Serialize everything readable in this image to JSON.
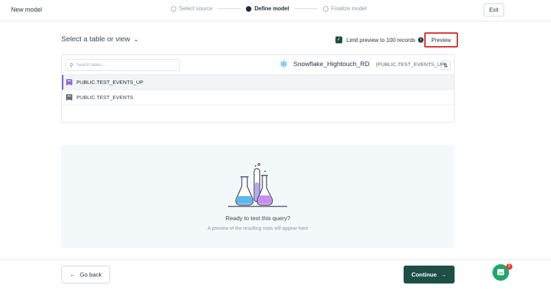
{
  "header": {
    "title": "New model",
    "steps": [
      {
        "label": "Select source",
        "state": "done"
      },
      {
        "label": "Define model",
        "state": "active"
      },
      {
        "label": "Finalize model",
        "state": "todo"
      }
    ],
    "exit_label": "Exit"
  },
  "selector": {
    "label": "Select a table or view",
    "limit_label": "Limit preview to 100 records",
    "limit_checked": true,
    "preview_label": "Preview"
  },
  "tables_panel": {
    "search_placeholder": "Search tables...",
    "source_name": "Snowflake_Hightouch_RD",
    "source_schema": "(PUBLIC.TEST_EVENTS_UP)",
    "rows": [
      {
        "label": "PUBLIC.TEST_EVENTS_UP",
        "selected": true
      },
      {
        "label": "PUBLIC.TEST_EVENTS",
        "selected": false
      }
    ]
  },
  "empty_state": {
    "title": "Ready to test this query?",
    "subtitle": "A preview of the resulting rows will appear here"
  },
  "footer": {
    "back_label": "Go back",
    "continue_label": "Continue",
    "chat_badge": "2"
  },
  "colors": {
    "primary": "#1d4f47",
    "highlight_border": "#d62b2b",
    "selected_row_accent": "#7c5cd6",
    "chat": "#1ea86a"
  }
}
